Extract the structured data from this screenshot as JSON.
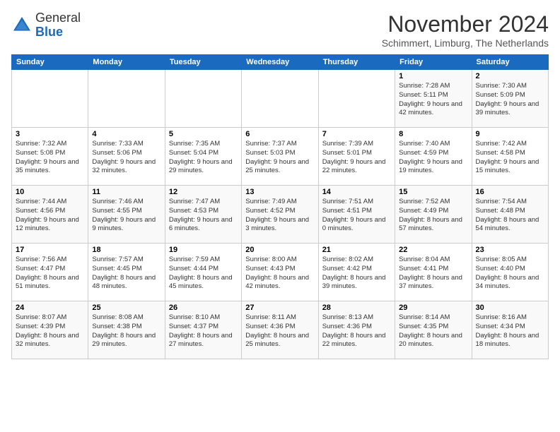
{
  "header": {
    "logo_line1": "General",
    "logo_line2": "Blue",
    "month_title": "November 2024",
    "subtitle": "Schimmert, Limburg, The Netherlands"
  },
  "days_of_week": [
    "Sunday",
    "Monday",
    "Tuesday",
    "Wednesday",
    "Thursday",
    "Friday",
    "Saturday"
  ],
  "weeks": [
    [
      {
        "day": "",
        "info": ""
      },
      {
        "day": "",
        "info": ""
      },
      {
        "day": "",
        "info": ""
      },
      {
        "day": "",
        "info": ""
      },
      {
        "day": "",
        "info": ""
      },
      {
        "day": "1",
        "info": "Sunrise: 7:28 AM\nSunset: 5:11 PM\nDaylight: 9 hours and 42 minutes."
      },
      {
        "day": "2",
        "info": "Sunrise: 7:30 AM\nSunset: 5:09 PM\nDaylight: 9 hours and 39 minutes."
      }
    ],
    [
      {
        "day": "3",
        "info": "Sunrise: 7:32 AM\nSunset: 5:08 PM\nDaylight: 9 hours and 35 minutes."
      },
      {
        "day": "4",
        "info": "Sunrise: 7:33 AM\nSunset: 5:06 PM\nDaylight: 9 hours and 32 minutes."
      },
      {
        "day": "5",
        "info": "Sunrise: 7:35 AM\nSunset: 5:04 PM\nDaylight: 9 hours and 29 minutes."
      },
      {
        "day": "6",
        "info": "Sunrise: 7:37 AM\nSunset: 5:03 PM\nDaylight: 9 hours and 25 minutes."
      },
      {
        "day": "7",
        "info": "Sunrise: 7:39 AM\nSunset: 5:01 PM\nDaylight: 9 hours and 22 minutes."
      },
      {
        "day": "8",
        "info": "Sunrise: 7:40 AM\nSunset: 4:59 PM\nDaylight: 9 hours and 19 minutes."
      },
      {
        "day": "9",
        "info": "Sunrise: 7:42 AM\nSunset: 4:58 PM\nDaylight: 9 hours and 15 minutes."
      }
    ],
    [
      {
        "day": "10",
        "info": "Sunrise: 7:44 AM\nSunset: 4:56 PM\nDaylight: 9 hours and 12 minutes."
      },
      {
        "day": "11",
        "info": "Sunrise: 7:46 AM\nSunset: 4:55 PM\nDaylight: 9 hours and 9 minutes."
      },
      {
        "day": "12",
        "info": "Sunrise: 7:47 AM\nSunset: 4:53 PM\nDaylight: 9 hours and 6 minutes."
      },
      {
        "day": "13",
        "info": "Sunrise: 7:49 AM\nSunset: 4:52 PM\nDaylight: 9 hours and 3 minutes."
      },
      {
        "day": "14",
        "info": "Sunrise: 7:51 AM\nSunset: 4:51 PM\nDaylight: 9 hours and 0 minutes."
      },
      {
        "day": "15",
        "info": "Sunrise: 7:52 AM\nSunset: 4:49 PM\nDaylight: 8 hours and 57 minutes."
      },
      {
        "day": "16",
        "info": "Sunrise: 7:54 AM\nSunset: 4:48 PM\nDaylight: 8 hours and 54 minutes."
      }
    ],
    [
      {
        "day": "17",
        "info": "Sunrise: 7:56 AM\nSunset: 4:47 PM\nDaylight: 8 hours and 51 minutes."
      },
      {
        "day": "18",
        "info": "Sunrise: 7:57 AM\nSunset: 4:45 PM\nDaylight: 8 hours and 48 minutes."
      },
      {
        "day": "19",
        "info": "Sunrise: 7:59 AM\nSunset: 4:44 PM\nDaylight: 8 hours and 45 minutes."
      },
      {
        "day": "20",
        "info": "Sunrise: 8:00 AM\nSunset: 4:43 PM\nDaylight: 8 hours and 42 minutes."
      },
      {
        "day": "21",
        "info": "Sunrise: 8:02 AM\nSunset: 4:42 PM\nDaylight: 8 hours and 39 minutes."
      },
      {
        "day": "22",
        "info": "Sunrise: 8:04 AM\nSunset: 4:41 PM\nDaylight: 8 hours and 37 minutes."
      },
      {
        "day": "23",
        "info": "Sunrise: 8:05 AM\nSunset: 4:40 PM\nDaylight: 8 hours and 34 minutes."
      }
    ],
    [
      {
        "day": "24",
        "info": "Sunrise: 8:07 AM\nSunset: 4:39 PM\nDaylight: 8 hours and 32 minutes."
      },
      {
        "day": "25",
        "info": "Sunrise: 8:08 AM\nSunset: 4:38 PM\nDaylight: 8 hours and 29 minutes."
      },
      {
        "day": "26",
        "info": "Sunrise: 8:10 AM\nSunset: 4:37 PM\nDaylight: 8 hours and 27 minutes."
      },
      {
        "day": "27",
        "info": "Sunrise: 8:11 AM\nSunset: 4:36 PM\nDaylight: 8 hours and 25 minutes."
      },
      {
        "day": "28",
        "info": "Sunrise: 8:13 AM\nSunset: 4:36 PM\nDaylight: 8 hours and 22 minutes."
      },
      {
        "day": "29",
        "info": "Sunrise: 8:14 AM\nSunset: 4:35 PM\nDaylight: 8 hours and 20 minutes."
      },
      {
        "day": "30",
        "info": "Sunrise: 8:16 AM\nSunset: 4:34 PM\nDaylight: 8 hours and 18 minutes."
      }
    ]
  ]
}
